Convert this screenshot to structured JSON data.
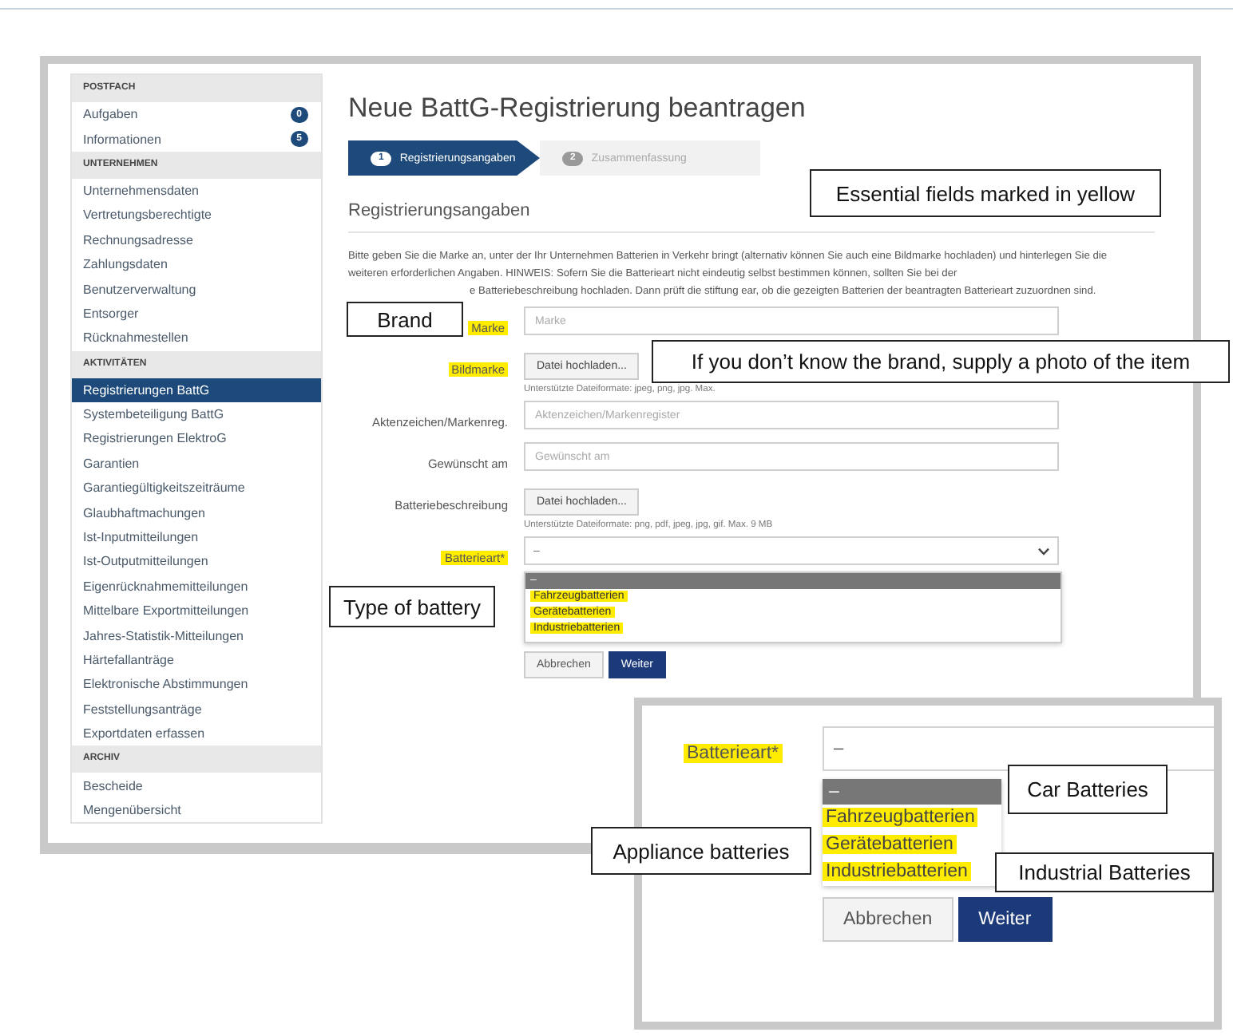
{
  "sidebar": {
    "sections": [
      {
        "title": "POSTFACH",
        "items": [
          {
            "label": "Aufgaben",
            "badge": "0",
            "selected": false
          },
          {
            "label": "Informationen",
            "badge": "5",
            "selected": false
          }
        ]
      },
      {
        "title": "UNTERNEHMEN",
        "items": [
          {
            "label": "Unternehmensdaten",
            "selected": false
          },
          {
            "label": "Vertretungsberechtigte",
            "selected": false
          },
          {
            "label": "Rechnungsadresse",
            "selected": false
          },
          {
            "label": "Zahlungsdaten",
            "selected": false
          },
          {
            "label": "Benutzerverwaltung",
            "selected": false
          },
          {
            "label": "Entsorger",
            "selected": false
          },
          {
            "label": "Rücknahmestellen",
            "selected": false
          }
        ]
      },
      {
        "title": "AKTIVITÄTEN",
        "items": [
          {
            "label": "Registrierungen BattG",
            "selected": true
          },
          {
            "label": "Systembeteiligung BattG",
            "selected": false
          },
          {
            "label": "Registrierungen ElektroG",
            "selected": false
          },
          {
            "label": "Garantien",
            "selected": false
          },
          {
            "label": "Garantiegültigkeitszeiträume",
            "selected": false
          },
          {
            "label": "Glaubhaftmachungen",
            "selected": false
          },
          {
            "label": "Ist-Inputmitteilungen",
            "selected": false
          },
          {
            "label": "Ist-Outputmitteilungen",
            "selected": false
          },
          {
            "label": "Eigenrücknahmemitteilungen",
            "selected": false
          },
          {
            "label": "Mittelbare Exportmitteilungen",
            "selected": false
          },
          {
            "label": "Jahres-Statistik-Mitteilungen",
            "selected": false
          },
          {
            "label": "Härtefallanträge",
            "selected": false
          },
          {
            "label": "Elektronische Abstimmungen",
            "selected": false
          },
          {
            "label": "Feststellungsanträge",
            "selected": false
          },
          {
            "label": "Exportdaten erfassen",
            "selected": false
          }
        ]
      },
      {
        "title": "ARCHIV",
        "items": [
          {
            "label": "Bescheide",
            "selected": false
          },
          {
            "label": "Mengenübersicht",
            "selected": false
          }
        ]
      }
    ]
  },
  "page": {
    "title": "Neue BattG-Registrierung beantragen",
    "steps": [
      {
        "number": "1",
        "label": "Registrierungsangaben",
        "selected": true
      },
      {
        "number": "2",
        "label": "Zusammenfassung",
        "selected": false
      }
    ],
    "section_title": "Registrierungsangaben",
    "intro": "Bitte geben Sie die Marke an, unter der Ihr Unternehmen Batterien in Verkehr bringt (alternativ können Sie auch eine Bildmarke hochladen) und hinterlegen Sie die weiteren erforderlichen Angaben. HINWEIS: Sofern Sie die Batterieart nicht eindeutig selbst bestimmen können, sollten Sie bei der",
    "intro_continued": "e Batteriebeschreibung hochladen. Dann prüft die stiftung ear, ob die gezeigten Batterien der beantragten Batterieart zuzuordnen sind.",
    "fields": [
      {
        "kind": "text",
        "label": "Marke",
        "highlighted": true,
        "placeholder": "Marke"
      },
      {
        "kind": "file",
        "label": "Bildmarke",
        "highlighted": true,
        "button": "Datei hochladen...",
        "hint": "Unterstützte Dateiformate: jpeg, png, jpg. Max."
      },
      {
        "kind": "text",
        "label": "Aktenzeichen/Markenreg.",
        "highlighted": false,
        "placeholder": "Aktenzeichen/Markenregister"
      },
      {
        "kind": "text",
        "label": "Gewünscht am",
        "highlighted": false,
        "placeholder": "Gewünscht am"
      },
      {
        "kind": "file",
        "label": "Batteriebeschreibung",
        "highlighted": false,
        "button": "Datei hochladen...",
        "hint": "Unterstützte Dateiformate: png, pdf, jpeg, jpg, gif. Max. 9 MB"
      },
      {
        "kind": "select",
        "label": "Batterieart*",
        "highlighted": true,
        "value": "–",
        "options": [
          {
            "label": "–",
            "selected": true,
            "highlighted": false
          },
          {
            "label": "Fahrzeugbatterien",
            "selected": false,
            "highlighted": true
          },
          {
            "label": "Gerätebatterien",
            "selected": false,
            "highlighted": true
          },
          {
            "label": "Industriebatterien",
            "selected": false,
            "highlighted": true
          }
        ]
      }
    ],
    "buttons": [
      {
        "label": "Abbrechen",
        "kind": "secondary"
      },
      {
        "label": "Weiter",
        "kind": "primary"
      }
    ]
  },
  "annotations": [
    "Essential fields marked in yellow",
    "Brand",
    "If you don’t know the brand, supply a photo of the item",
    "Type of battery"
  ],
  "zoom_inset": {
    "label": "Batterieart*",
    "highlighted": true,
    "value": "–",
    "options": [
      {
        "label": "–",
        "selected": true,
        "highlighted": false
      },
      {
        "label": "Fahrzeugbatterien",
        "selected": false,
        "highlighted": true
      },
      {
        "label": "Gerätebatterien",
        "selected": false,
        "highlighted": true
      },
      {
        "label": "Industriebatterien",
        "selected": false,
        "highlighted": true
      }
    ],
    "buttons": [
      {
        "label": "Abbrechen",
        "kind": "secondary"
      },
      {
        "label": "Weiter",
        "kind": "primary"
      }
    ],
    "annotations": [
      "Car Batteries",
      "Appliance batteries",
      "Industrial Batteries"
    ]
  }
}
